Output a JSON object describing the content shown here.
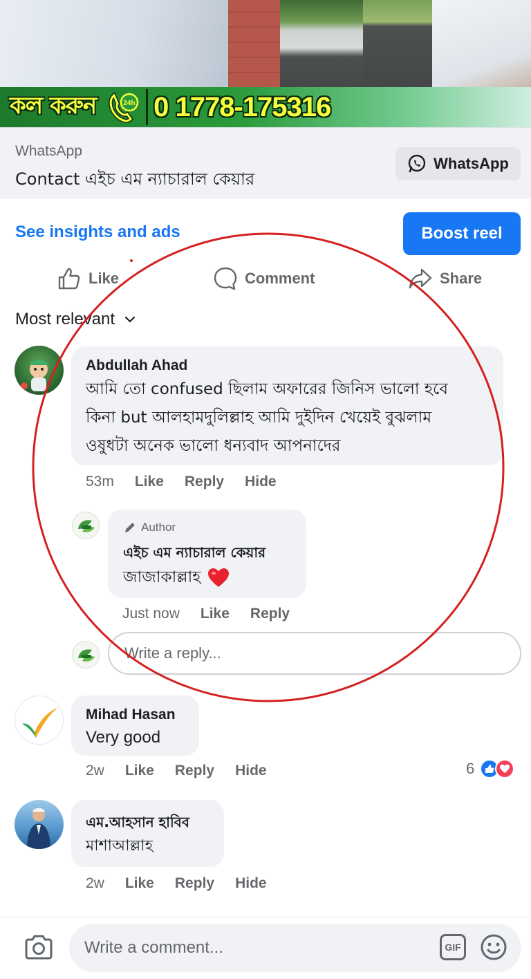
{
  "banner": {
    "call_text": "কল করুন",
    "hours_badge": "24h",
    "phone_number": "0 1778-175316"
  },
  "cta": {
    "platform_label": "WhatsApp",
    "title": "Contact এইচ এম ন্যাচারাল কেয়ার",
    "button_label": "WhatsApp"
  },
  "insights": {
    "link_label": "See insights and ads",
    "boost_label": "Boost reel"
  },
  "actions": {
    "like_label": "Like",
    "comment_label": "Comment",
    "share_label": "Share"
  },
  "sort": {
    "label": "Most relevant"
  },
  "comments": [
    {
      "author": "Abdullah Ahad",
      "lines": [
        "আমি তো confused  ছিলাম অফারের জিনিস ভালো হবে",
        "কিনা but আলহামদুলিল্লাহ আমি দুইদিন খেয়েই বুঝলাম",
        "ওষুধটা অনেক ভালো ধন্যবাদ আপনাদের"
      ],
      "time": "53m",
      "like_label": "Like",
      "reply_label": "Reply",
      "hide_label": "Hide",
      "reply": {
        "badge": "Author",
        "author": "এইচ এম ন্যাচারাল কেয়ার",
        "text": "জাজাকাল্লাহ",
        "emoji": "❤️",
        "time": "Just now",
        "like_label": "Like",
        "reply_label": "Reply"
      }
    },
    {
      "author": "Mihad Hasan",
      "text": "Very good",
      "time": "2w",
      "like_label": "Like",
      "reply_label": "Reply",
      "hide_label": "Hide",
      "reaction_count": "6"
    },
    {
      "author": "এম.আহসান হাবিব",
      "text": "মাশাআল্লাহ",
      "time": "2w",
      "like_label": "Like",
      "reply_label": "Reply",
      "hide_label": "Hide"
    }
  ],
  "reply_input": {
    "placeholder": "Write a reply..."
  },
  "composer": {
    "placeholder": "Write a comment...",
    "gif_label": "GIF"
  },
  "colors": {
    "accent": "#1877f2",
    "annotation": "#d42020",
    "banner_green": "#2a9a3a",
    "banner_yellow": "#f6ff3d"
  }
}
